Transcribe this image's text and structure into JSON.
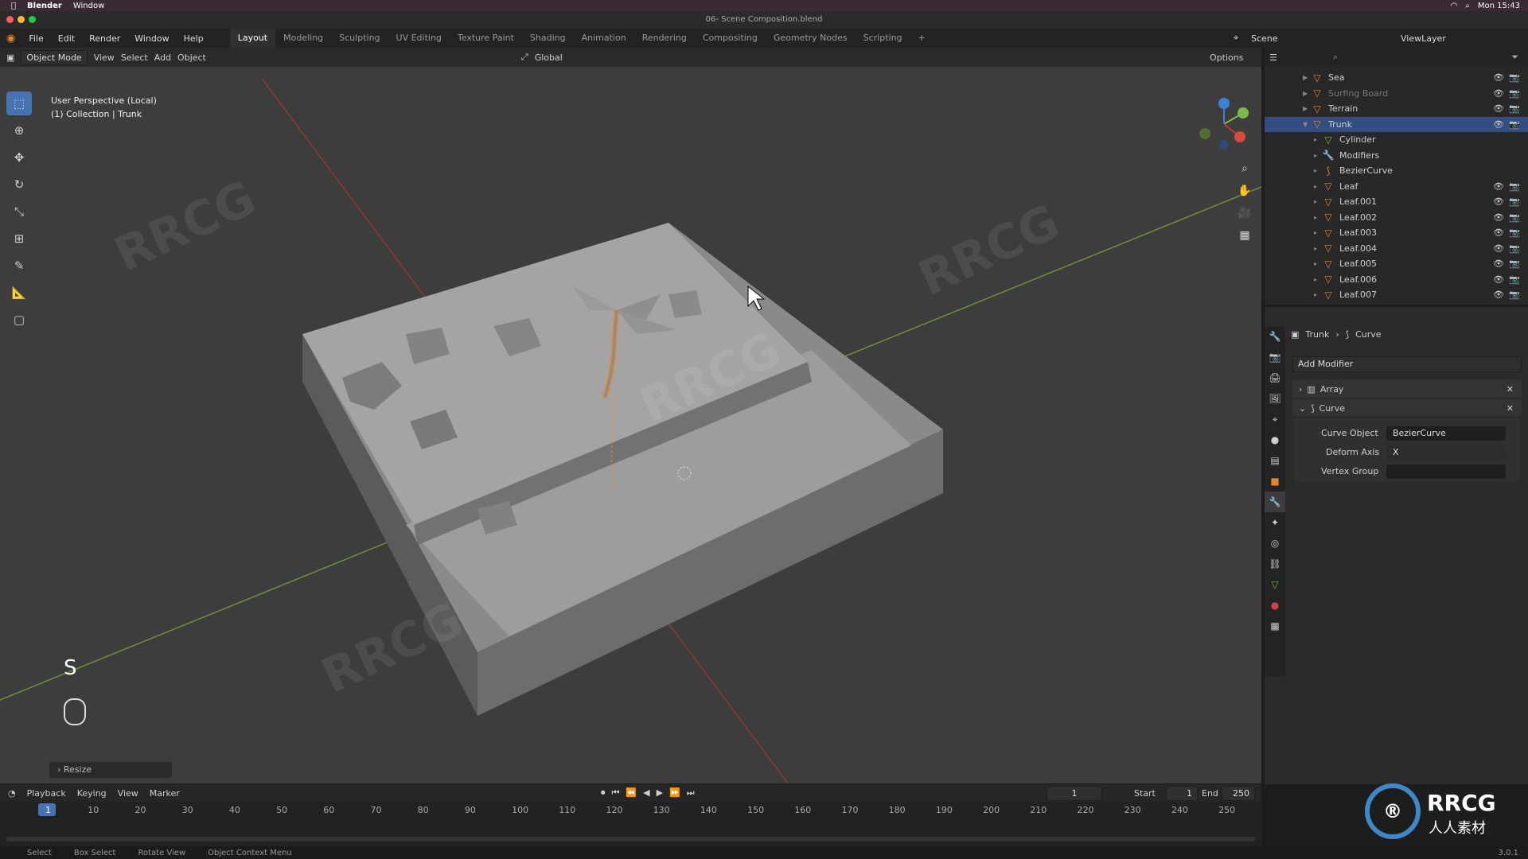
{
  "macbar": {
    "app": "Blender",
    "menu_window": "Window",
    "clock": "Mon 15:43"
  },
  "title": "06- Scene Composition.blend",
  "watermark_tag": "RRCG",
  "menu": [
    "File",
    "Edit",
    "Render",
    "Window",
    "Help"
  ],
  "workspaces": [
    "Layout",
    "Modeling",
    "Sculpting",
    "UV Editing",
    "Texture Paint",
    "Shading",
    "Animation",
    "Rendering",
    "Compositing",
    "Geometry Nodes",
    "Scripting"
  ],
  "active_workspace": "Layout",
  "scene_label": "Scene",
  "viewlayer_label": "ViewLayer",
  "viewport_header": {
    "mode": "Object Mode",
    "view": "View",
    "select": "Select",
    "add": "Add",
    "object": "Object",
    "transform": "Global",
    "options": "Options"
  },
  "viewport_info": {
    "line1": "User Perspective (Local)",
    "line2": "(1) Collection | Trunk"
  },
  "key_hint": "S",
  "resize_panel": "Resize",
  "outliner_rows": [
    {
      "name": "Sea",
      "level": 1,
      "icon": "mesh-object-icon"
    },
    {
      "name": "Surfing Board",
      "level": 1,
      "icon": "mesh-object-icon"
    },
    {
      "name": "Terrain",
      "level": 1,
      "icon": "mesh-object-icon"
    },
    {
      "name": "Trunk",
      "level": 1,
      "icon": "mesh-object-icon",
      "selected": true
    },
    {
      "name": "Cylinder",
      "level": 2,
      "icon": "mesh-data-icon"
    },
    {
      "name": "Modifiers",
      "level": 2,
      "icon": "wrench-icon"
    },
    {
      "name": "BezierCurve",
      "level": 2,
      "icon": "curve-icon"
    },
    {
      "name": "Leaf",
      "level": 2,
      "icon": "mesh-object-icon"
    },
    {
      "name": "Leaf.001",
      "level": 2,
      "icon": "mesh-object-icon"
    },
    {
      "name": "Leaf.002",
      "level": 2,
      "icon": "mesh-object-icon"
    },
    {
      "name": "Leaf.003",
      "level": 2,
      "icon": "mesh-object-icon"
    },
    {
      "name": "Leaf.004",
      "level": 2,
      "icon": "mesh-object-icon"
    },
    {
      "name": "Leaf.005",
      "level": 2,
      "icon": "mesh-object-icon"
    },
    {
      "name": "Leaf.006",
      "level": 2,
      "icon": "mesh-object-icon"
    },
    {
      "name": "Leaf.007",
      "level": 2,
      "icon": "mesh-object-icon"
    }
  ],
  "props": {
    "breadcrumb_obj": "Trunk",
    "breadcrumb_mod": "Curve",
    "add_modifier": "Add Modifier",
    "modifiers": [
      "Array",
      "Curve"
    ],
    "curve_object_label": "Curve Object",
    "curve_object_value": "BezierCurve",
    "deform_axis_label": "Deform Axis",
    "deform_axis_value": "X",
    "vertex_group_label": "Vertex Group"
  },
  "timeline": {
    "menus": [
      "Playback",
      "Keying",
      "View",
      "Marker"
    ],
    "current_frame": "1",
    "start_label": "Start",
    "start": "1",
    "end_label": "End",
    "end": "250",
    "ticks": [
      "1",
      "10",
      "20",
      "30",
      "40",
      "50",
      "60",
      "70",
      "80",
      "90",
      "100",
      "110",
      "120",
      "130",
      "140",
      "150",
      "160",
      "170",
      "180",
      "190",
      "200",
      "210",
      "220",
      "230",
      "240",
      "250"
    ]
  },
  "status": [
    "Select",
    "Box Select",
    "Rotate View",
    "Object Context Menu"
  ],
  "version": "3.0.1",
  "logo": {
    "brand": "RRCG",
    "sub": "人人素材"
  },
  "colors": {
    "accent": "#4772b3",
    "selection": "#f08d2b",
    "x_axis": "#c0392b",
    "y_axis": "#7ab84a"
  }
}
